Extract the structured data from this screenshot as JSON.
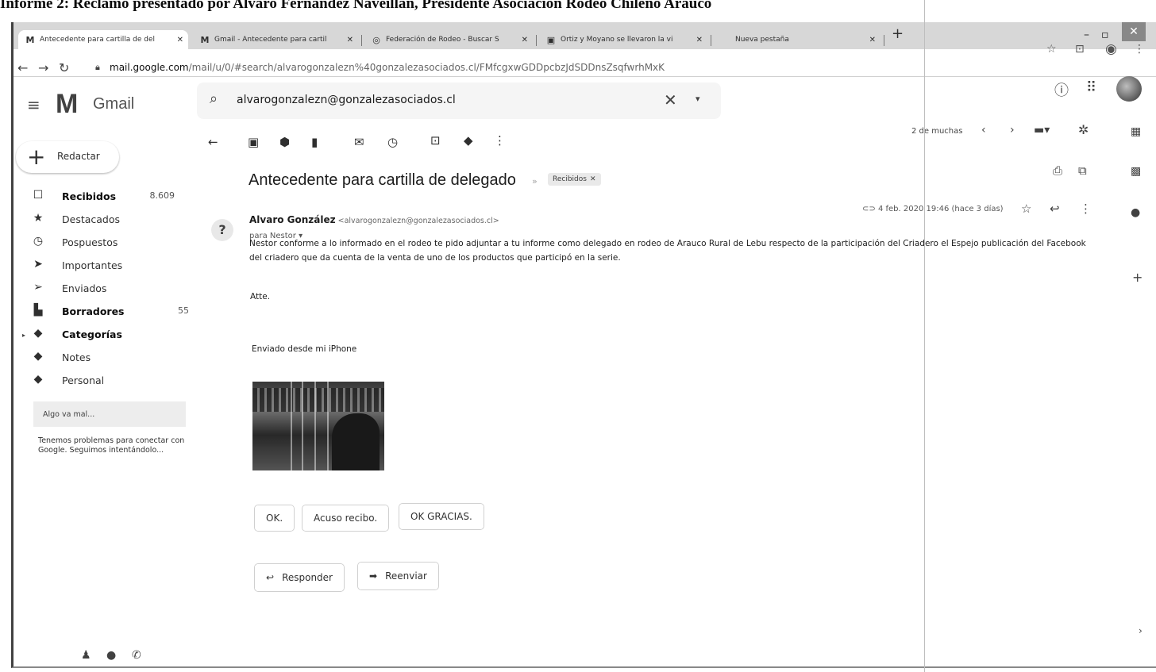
{
  "document_title": "Informe 2: Reclamo presentado por Alvaro Fernandez Naveillan, Presidente Asociación Rodeo Chileno Arauco",
  "browser": {
    "tabs": [
      {
        "title": "Antecedente para cartilla de del",
        "icon": "M",
        "active": true
      },
      {
        "title": "Gmail - Antecedente para cartil",
        "icon": "M",
        "active": false
      },
      {
        "title": "Federación de Rodeo - Buscar S",
        "icon": "◎",
        "active": false
      },
      {
        "title": "Ortiz y Moyano se llevaron la vi",
        "icon": "▣",
        "active": false
      },
      {
        "title": "Nueva pestaña",
        "icon": "",
        "active": false
      }
    ],
    "new_tab": "+",
    "url_host": "mail.google.com",
    "url_path": "/mail/u/0/#search/alvarogonzalezn%40gonzalezasociados.cl/FMfcgxwGDDpcbzJdSDDnsZsqfwrhMxK"
  },
  "gmail": {
    "product_name": "Gmail",
    "search_value": "alvarogonzalezn@gonzalezasociados.cl",
    "compose_label": "Redactar",
    "sidebar": [
      {
        "label": "Recibidos",
        "count": "8.609",
        "bold": true,
        "icon": "inbox-icon"
      },
      {
        "label": "Destacados",
        "count": "",
        "bold": false,
        "icon": "star-icon"
      },
      {
        "label": "Pospuestos",
        "count": "",
        "bold": false,
        "icon": "clock-icon"
      },
      {
        "label": "Importantes",
        "count": "",
        "bold": false,
        "icon": "important-icon"
      },
      {
        "label": "Enviados",
        "count": "",
        "bold": false,
        "icon": "send-icon"
      },
      {
        "label": "Borradores",
        "count": "55",
        "bold": true,
        "icon": "draft-icon"
      },
      {
        "label": "Categorías",
        "count": "",
        "bold": true,
        "icon": "label-icon"
      },
      {
        "label": "Notes",
        "count": "",
        "bold": false,
        "icon": "label-icon"
      },
      {
        "label": "Personal",
        "count": "",
        "bold": false,
        "icon": "label-icon"
      }
    ],
    "error_title": "Algo va mal...",
    "error_text": "Tenemos problemas para conectar con Google. Seguimos intentándolo...",
    "pager": "2 de muchas"
  },
  "message": {
    "subject": "Antecedente para cartilla de delegado",
    "label_chip": "Recibidos",
    "sender_initial": "?",
    "sender_name": "Alvaro González",
    "sender_email": "<alvarogonzalezn@gonzalezasociados.cl>",
    "to": "para Nestor",
    "date": "4 feb. 2020 19:46 (hace 3 días)",
    "body": "Nestor conforme a lo informado en el rodeo te pido adjuntar a tu informe como delegado en rodeo de Arauco Rural de Lebu respecto de la participación del Criadero el Espejo publicación del Facebook del criadero que da cuenta de la venta de uno de los productos que participó en la serie.",
    "closing": "Atte.",
    "signature": "Enviado desde mi iPhone",
    "smart_replies": [
      "OK.",
      "Acuso recibo.",
      "OK GRACIAS."
    ],
    "reply_label": "Responder",
    "forward_label": "Reenviar"
  }
}
